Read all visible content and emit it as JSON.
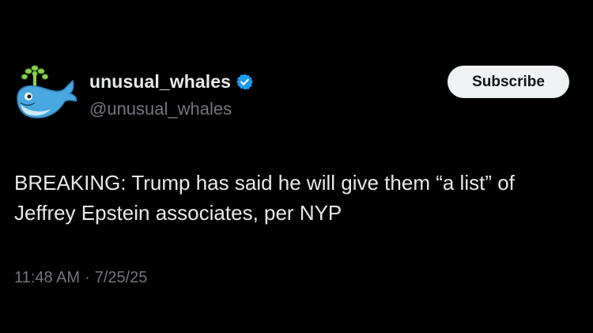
{
  "author": {
    "display_name": "unusual_whales",
    "handle": "@unusual_whales",
    "verified": true,
    "avatar_icon": "whale-icon"
  },
  "subscribe_label": "Subscribe",
  "tweet": {
    "text": "BREAKING: Trump has said he will give them “a list” of Jeffrey Epstein associates, per NYP",
    "time": "11:48 AM",
    "separator": "·",
    "date": "7/25/25"
  },
  "colors": {
    "background": "#000000",
    "primary_text": "#e7e9ea",
    "secondary_text": "#71767b",
    "verified_badge": "#1d9bf0",
    "button_bg": "#eff3f4",
    "whale_body": "#4aa8e0",
    "whale_spout": "#7fc64a"
  }
}
